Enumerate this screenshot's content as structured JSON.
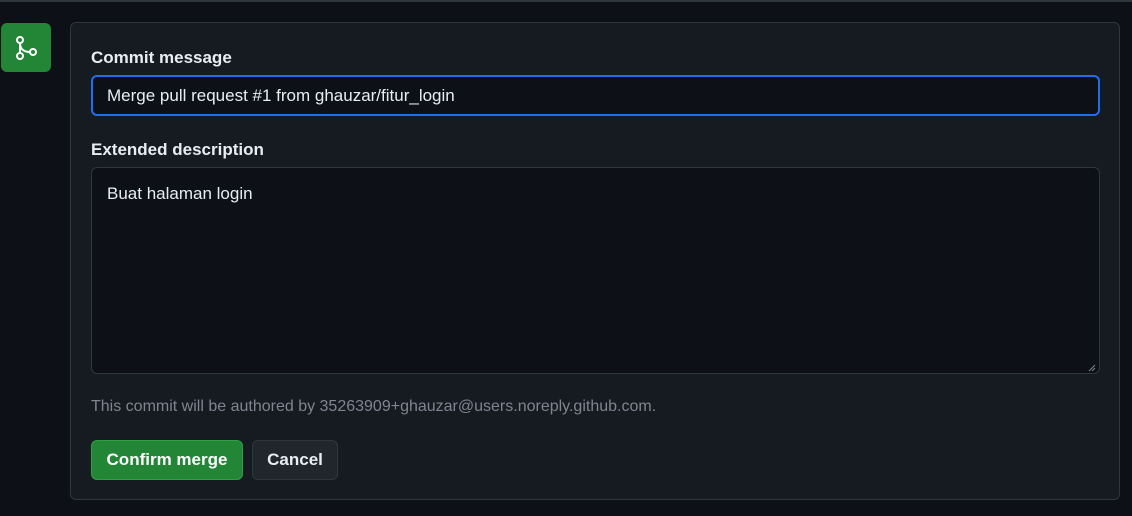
{
  "merge_form": {
    "commit_message_label": "Commit message",
    "commit_message_value": "Merge pull request #1 from ghauzar/fitur_login",
    "extended_description_label": "Extended description",
    "extended_description_value": "Buat halaman login",
    "author_note": "This commit will be authored by 35263909+ghauzar@users.noreply.github.com.",
    "confirm_label": "Confirm merge",
    "cancel_label": "Cancel"
  },
  "icons": {
    "merge_badge": "git-merge-icon",
    "resize_grip": "resize-handle-icon"
  },
  "colors": {
    "background": "#0d1117",
    "panel": "#161b22",
    "border": "#30363d",
    "focus_border": "#1f6feb",
    "primary_button": "#238636",
    "secondary_button": "#21262d",
    "muted_text": "#7d8590",
    "text": "#e6edf3"
  }
}
